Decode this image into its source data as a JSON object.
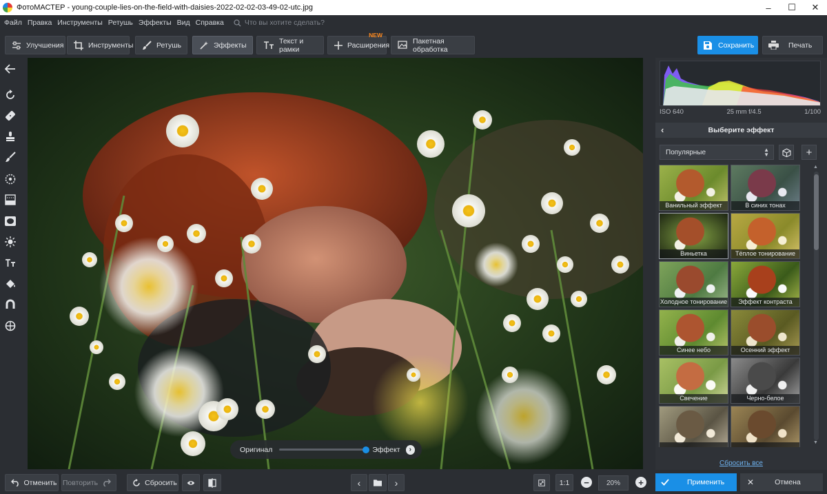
{
  "window": {
    "title": "ФотоМАСТЕР - young-couple-lies-on-the-field-with-daisies-2022-02-02-03-49-02-utc.jpg"
  },
  "menu": {
    "items": [
      "Файл",
      "Правка",
      "Инструменты",
      "Ретушь",
      "Эффекты",
      "Вид",
      "Справка"
    ],
    "search_placeholder": "Что вы хотите сделать?"
  },
  "toolbar": {
    "improve": "Улучшения",
    "tools": "Инструменты",
    "retouch": "Ретушь",
    "effects": "Эффекты",
    "text_frames": "Текст и рамки",
    "extensions": "Расширения",
    "extensions_badge": "NEW",
    "batch": "Пакетная обработка",
    "save": "Сохранить",
    "print": "Печать"
  },
  "compare": {
    "original": "Оригинал",
    "effect": "Эффект",
    "effect_strength": 1.0
  },
  "histogram": {
    "iso": "ISO 640",
    "lens": "25 mm f/4.5",
    "shutter": "1/100"
  },
  "effects_panel": {
    "header": "Выберите эффект",
    "category": "Популярные",
    "reset_all": "Сбросить все",
    "effects": [
      {
        "label": "Ванильный эффект",
        "tone": "vanilla"
      },
      {
        "label": "В синих тонах",
        "tone": "blue"
      },
      {
        "label": "Виньетка",
        "tone": "vignette"
      },
      {
        "label": "Тёплое тонирование",
        "tone": "warm"
      },
      {
        "label": "Холодное тонирование",
        "tone": "cold"
      },
      {
        "label": "Эффект контраста",
        "tone": "contrast"
      },
      {
        "label": "Синее небо",
        "tone": "sky"
      },
      {
        "label": "Осенний эффект",
        "tone": "autumn"
      },
      {
        "label": "Свечение",
        "tone": "glow"
      },
      {
        "label": "Черно-белое",
        "tone": "bw"
      },
      {
        "label": "",
        "tone": "sepia"
      },
      {
        "label": "",
        "tone": "sepia2"
      }
    ]
  },
  "bottombar": {
    "undo": "Отменить",
    "redo": "Повторить",
    "reset": "Сбросить",
    "ratio": "1:1",
    "zoom": "20%",
    "apply": "Применить",
    "cancel": "Отмена"
  },
  "colors": {
    "accent": "#1a8fe6",
    "new_badge": "#ff8a1f",
    "background": "#2b2e33"
  }
}
